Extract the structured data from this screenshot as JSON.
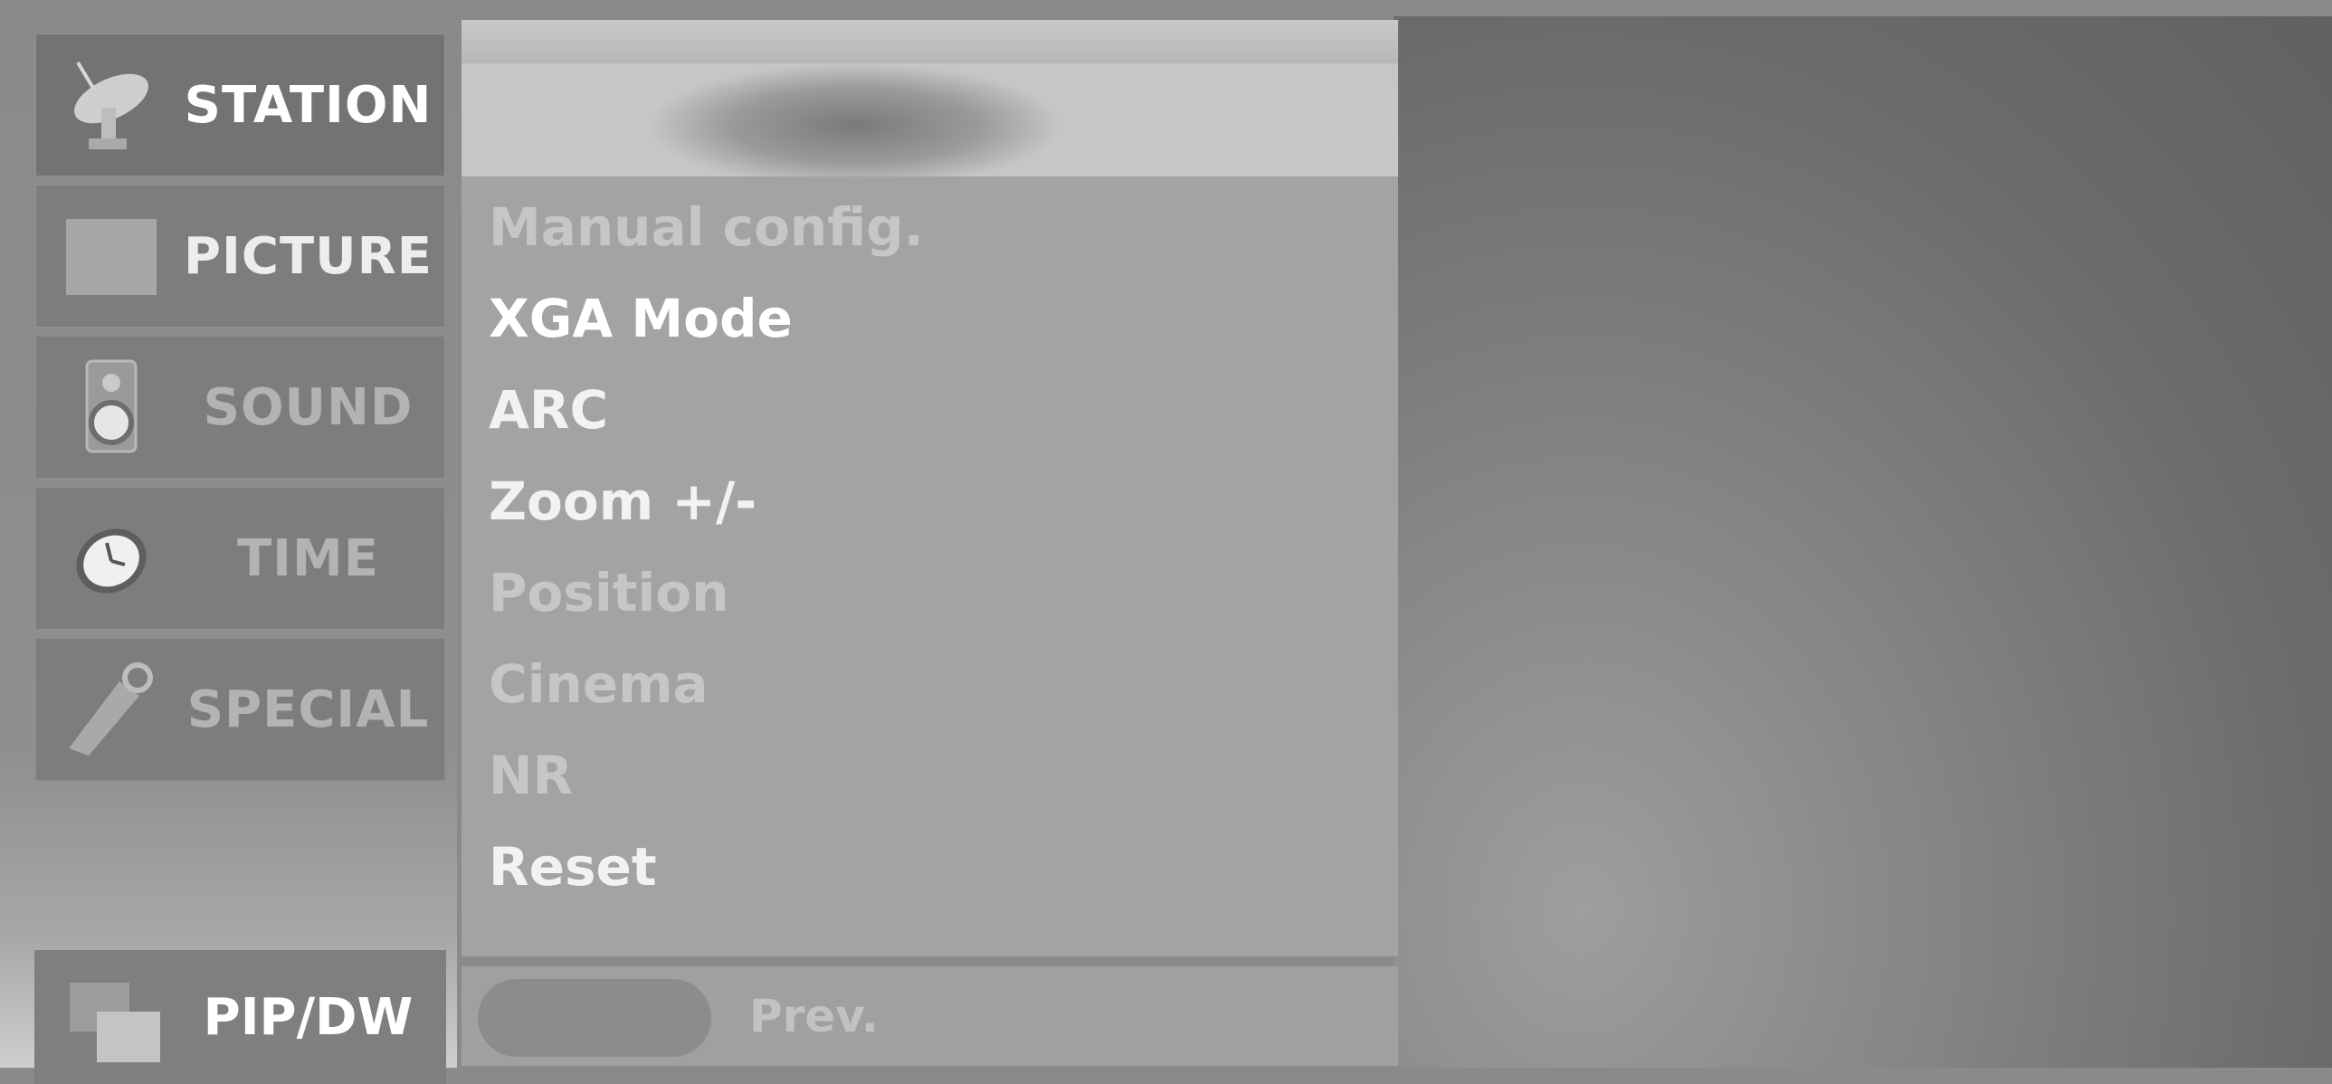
{
  "sidebar": {
    "items": [
      {
        "label": "STATION",
        "icon": "satellite-dish-icon",
        "state": "active"
      },
      {
        "label": "PICTURE",
        "icon": "picture-square-icon",
        "state": "enabled"
      },
      {
        "label": "SOUND",
        "icon": "speaker-icon",
        "state": "disabled"
      },
      {
        "label": "TIME",
        "icon": "clock-icon",
        "state": "disabled"
      },
      {
        "label": "SPECIAL",
        "icon": "tag-icon",
        "state": "disabled"
      }
    ],
    "pip": {
      "label": "PIP/DW",
      "icon": "overlapping-windows-icon"
    }
  },
  "submenu": {
    "items": [
      {
        "label": "Manual config.",
        "state": "dim"
      },
      {
        "label": "XGA Mode",
        "state": "bright"
      },
      {
        "label": "ARC",
        "state": "normal"
      },
      {
        "label": "Zoom +/-",
        "state": "normal"
      },
      {
        "label": "Position",
        "state": "dim"
      },
      {
        "label": "Cinema",
        "state": "dim"
      },
      {
        "label": "NR",
        "state": "dim"
      },
      {
        "label": "Reset",
        "state": "normal"
      }
    ]
  },
  "footer": {
    "prev_label": "Prev."
  }
}
